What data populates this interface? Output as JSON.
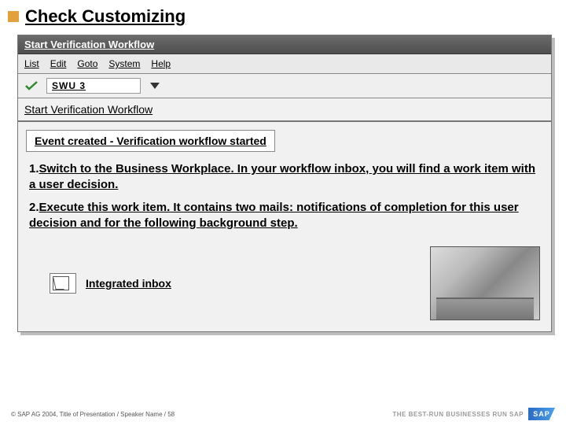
{
  "header": {
    "title": "Check Customizing"
  },
  "window": {
    "title": "Start Verification Workflow",
    "menus": [
      "List",
      "Edit",
      "Goto",
      "System",
      "Help"
    ],
    "transaction_code": "SWU 3",
    "subtitle": "Start Verification Workflow",
    "status_message": "Event created - Verification workflow started",
    "steps": {
      "s1_num": "1. ",
      "s1_a": "Switch to the Business Workplace.",
      "s1_b": " In your workflow inbox, you will find a work item with a user decision.",
      "s2_num": "2. ",
      "s2_a": "Execute this work item.",
      "s2_b": " It contains two mails: notifications of completion for this user decision and for the following background step."
    },
    "inbox_label": "Integrated inbox"
  },
  "footer": {
    "copyright": "© SAP AG 2004, Title of Presentation / Speaker Name / 58",
    "tagline": "THE BEST-RUN BUSINESSES RUN SAP",
    "logo_text": "SAP"
  }
}
